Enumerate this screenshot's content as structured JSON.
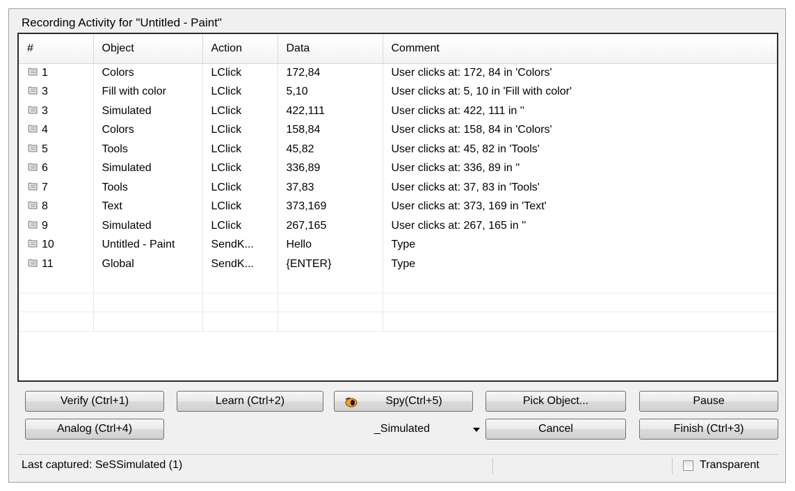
{
  "window": {
    "title": "Recording Activity for \"Untitled - Paint\""
  },
  "table": {
    "columns": [
      "#",
      "Object",
      "Action",
      "Data",
      "Comment"
    ],
    "rows": [
      {
        "num": "1",
        "object": "Colors",
        "action": "LClick",
        "data": "172,84",
        "comment": "User clicks at: 172, 84 in 'Colors'"
      },
      {
        "num": "3",
        "object": "Fill with color",
        "action": "LClick",
        "data": "5,10",
        "comment": "User clicks at: 5, 10 in 'Fill with color'"
      },
      {
        "num": "3",
        "object": "Simulated",
        "action": "LClick",
        "data": "422,111",
        "comment": "User clicks at: 422, 111 in ''"
      },
      {
        "num": "4",
        "object": "Colors",
        "action": "LClick",
        "data": "158,84",
        "comment": "User clicks at: 158, 84 in 'Colors'"
      },
      {
        "num": "5",
        "object": "Tools",
        "action": "LClick",
        "data": "45,82",
        "comment": "User clicks at: 45, 82 in 'Tools'"
      },
      {
        "num": "6",
        "object": "Simulated",
        "action": "LClick",
        "data": "336,89",
        "comment": "User clicks at: 336, 89 in ''"
      },
      {
        "num": "7",
        "object": "Tools",
        "action": "LClick",
        "data": "37,83",
        "comment": "User clicks at: 37, 83 in 'Tools'"
      },
      {
        "num": "8",
        "object": "Text",
        "action": "LClick",
        "data": "373,169",
        "comment": "User clicks at: 373, 169 in 'Text'"
      },
      {
        "num": "9",
        "object": "Simulated",
        "action": "LClick",
        "data": "267,165",
        "comment": "User clicks at: 267, 165 in ''"
      },
      {
        "num": "10",
        "object": "Untitled - Paint",
        "action": "SendK...",
        "data": "Hello",
        "comment": "Type"
      },
      {
        "num": "11",
        "object": "Global",
        "action": "SendK...",
        "data": "{ENTER}",
        "comment": "Type"
      }
    ],
    "row_icon": "script-scroll-icon"
  },
  "buttons": {
    "verify": "Verify (Ctrl+1)",
    "learn": "Learn (Ctrl+2)",
    "spy": "Spy(Ctrl+5)",
    "pick_object": "Pick Object...",
    "pause": "Pause",
    "analog": "Analog (Ctrl+4)",
    "cancel": "Cancel",
    "finish": "Finish (Ctrl+3)"
  },
  "mode_select": {
    "value": "_Simulated"
  },
  "status": {
    "text": "Last captured: SeSSimulated (1)",
    "transparent_label": "Transparent",
    "transparent_checked": false
  },
  "colors": {
    "grid_border": "#2b2b2b",
    "window_bg": "#f0f0f0"
  }
}
